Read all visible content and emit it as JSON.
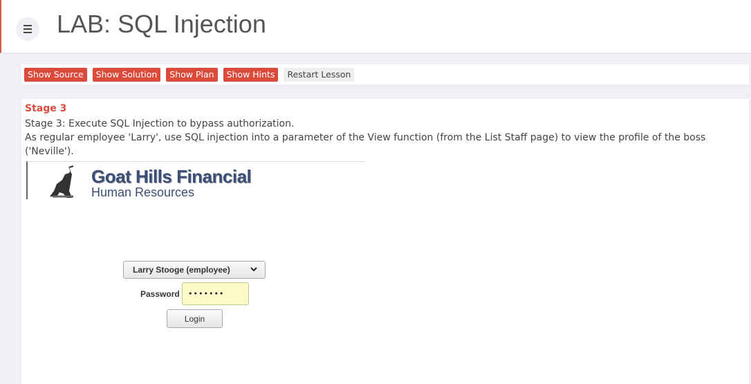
{
  "header": {
    "title": "LAB: SQL Injection"
  },
  "toolbar": {
    "show_source": "Show Source",
    "show_solution": "Show Solution",
    "show_plan": "Show Plan",
    "show_hints": "Show Hints",
    "restart_lesson": "Restart Lesson"
  },
  "lesson": {
    "stage_title": "Stage 3",
    "line1": "Stage 3: Execute SQL Injection to bypass authorization.",
    "line2": "As regular employee 'Larry', use SQL injection into a parameter of the View function (from the List Staff page) to view the profile of the boss ('Neville')."
  },
  "app": {
    "logo_title": "Goat Hills Financial",
    "logo_subtitle": "Human Resources",
    "user_selected": "Larry Stooge (employee)",
    "password_label": "Password",
    "password_value": "•••••••",
    "login_label": "Login"
  },
  "colors": {
    "accent": "#dd4a3b",
    "password_bg": "#fdfbc8"
  }
}
